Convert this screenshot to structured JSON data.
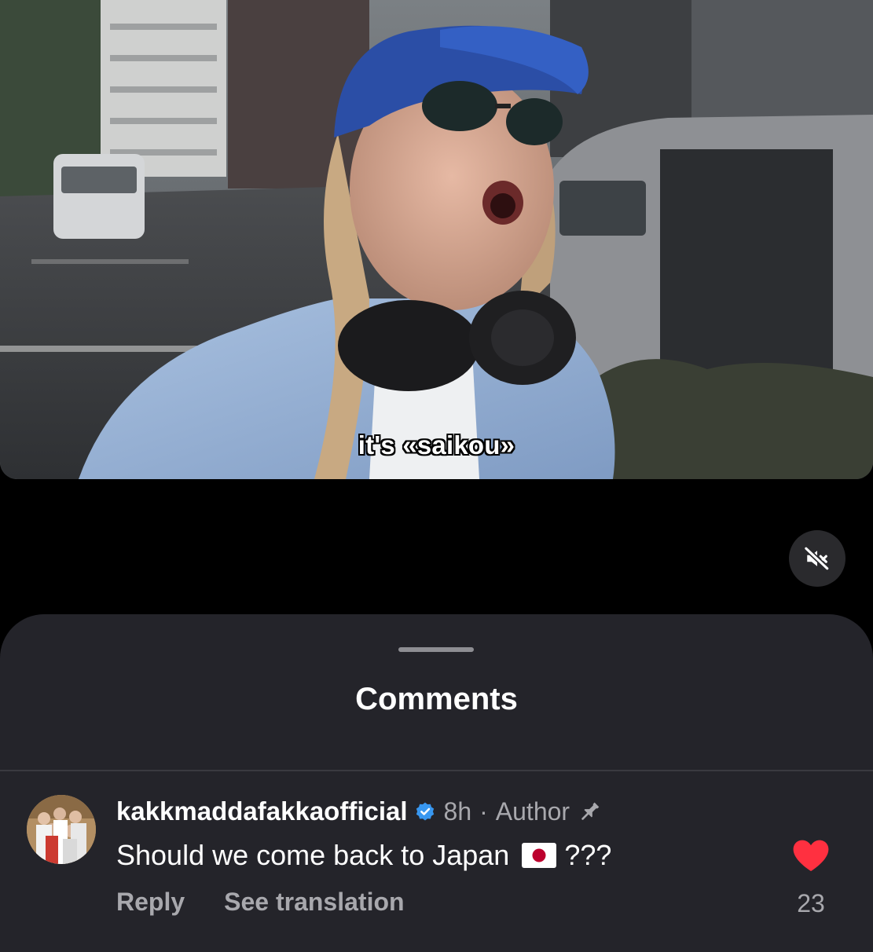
{
  "video": {
    "caption": "it's «saikou»",
    "muted": true,
    "mute_icon": "speaker-muted-icon"
  },
  "comments_sheet": {
    "title": "Comments",
    "comments": [
      {
        "username": "kakkmaddafakkaofficial",
        "verified": true,
        "time": "8h",
        "separator": "·",
        "role": "Author",
        "pinned": true,
        "text": "Should we come back to Japan",
        "flag": "japan-flag-icon",
        "text_suffix": "???",
        "reply_label": "Reply",
        "translate_label": "See translation",
        "like_count": "23",
        "liked": true,
        "like_color": "#ff3040"
      }
    ]
  },
  "colors": {
    "sheet_background": "#24242a",
    "muted_text": "#a8a8ad",
    "verified_badge": "#3897f0"
  }
}
